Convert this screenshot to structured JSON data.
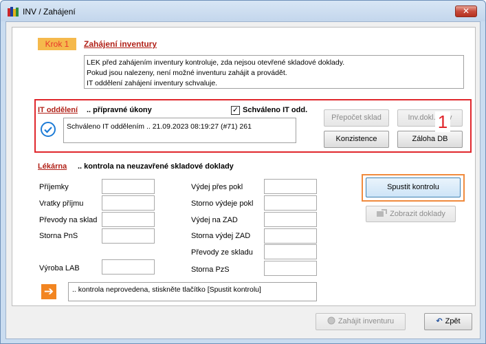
{
  "window": {
    "title": "INV / Zahájení",
    "close_glyph": "✕"
  },
  "krok": {
    "badge": "Krok 1",
    "title": "Zahájení inventury",
    "description": [
      "LEK před zahájením inventury kontroluje, zda nejsou otevřené skladové doklady.",
      "Pokud jsou nalezeny, není možné inventuru zahájit a provádět.",
      "IT oddělení zahájení inventury schvaluje."
    ]
  },
  "it_section": {
    "label": "IT oddělení",
    "subtitle": ".. přípravné úkony",
    "approved_checkbox_label": "Schváleno IT odd.",
    "approved_checked": true,
    "check_glyph": "✓",
    "status_text": "Schváleno IT oddělením .. 21.09.2023 08:19:27 (#71) 261",
    "buttons": {
      "prepocet": "Přepočet sklad",
      "inv_doklady": "Inv.dokl. ...av",
      "konzistence": "Konzistence",
      "zaloha": "Záloha DB"
    },
    "annotation_number": "1"
  },
  "lekarna_section": {
    "label": "Lékárna",
    "subtitle": ".. kontrola na neuzavřené skladové doklady",
    "left_fields": {
      "prijemky": "Příjemky",
      "vratky": "Vratky příjmu",
      "prevody_na_sklad": "Převody na sklad",
      "storna_pns": "Storna PnS",
      "vyroba_lab": "Výroba LAB"
    },
    "right_fields": {
      "vydej_pres_pokl": "Výdej přes pokl",
      "storno_vydeje_pokl": "Storno výdeje pokl",
      "vydej_na_zad": "Výdej na ZAD",
      "storna_vydej_zad": "Storna výdej ZAD",
      "prevody_ze_skladu": "Převody ze skladu",
      "storna_pzs": "Storna PzS"
    },
    "spustit_button": "Spustit kontrolu",
    "zobrazit_button": "Zobrazit doklady",
    "arrow_glyph": "➔",
    "result_text": ".. kontrola neprovedena, stiskněte tlačítko [Spustit kontrolu]"
  },
  "footer": {
    "zahajit_button": "Zahájit inventuru",
    "zpet_button": "Zpět"
  },
  "colors": {
    "accent_red": "#e0262b",
    "section_label": "#b12118",
    "badge_bg": "#f5b94c",
    "highlight_orange": "#f08a3c"
  }
}
